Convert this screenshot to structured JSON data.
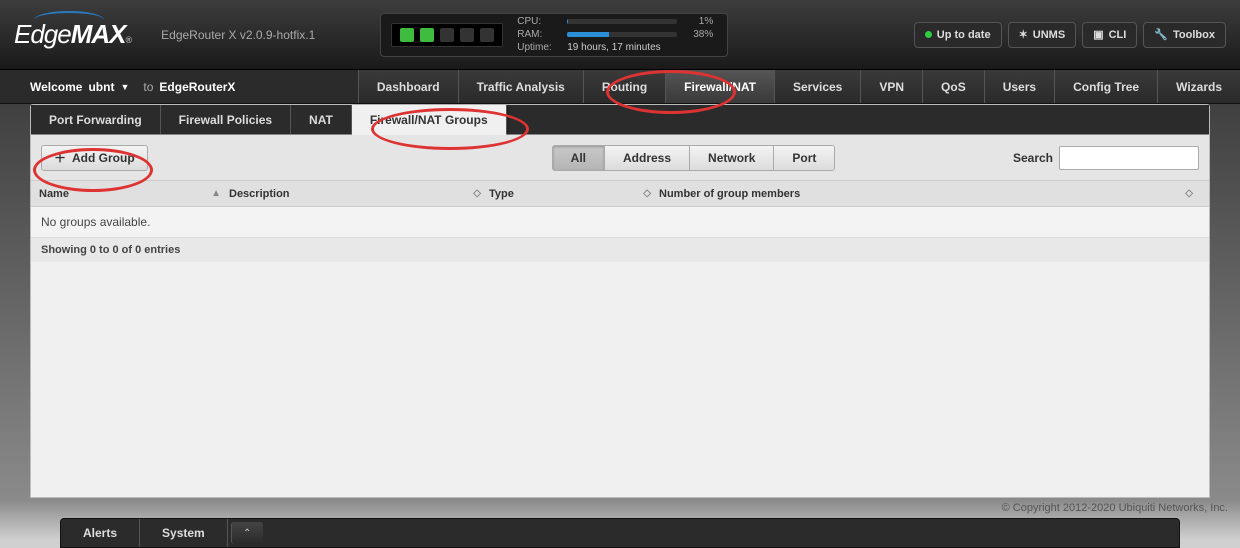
{
  "brand": {
    "part1": "Edge",
    "part2": "MAX",
    "reg": "®"
  },
  "model": "EdgeRouter X v2.0.9-hotfix.1",
  "stats": {
    "cpu_label": "CPU:",
    "cpu_pct": 1,
    "cpu_text": "1%",
    "ram_label": "RAM:",
    "ram_pct": 38,
    "ram_text": "38%",
    "uptime_label": "Uptime:",
    "uptime_text": "19 hours, 17 minutes"
  },
  "header_buttons": {
    "uptodate": "Up to date",
    "unms": "UNMS",
    "cli": "CLI",
    "toolbox": "Toolbox"
  },
  "welcome": {
    "prefix": "Welcome ",
    "user": "ubnt",
    "to": "to ",
    "device": "EdgeRouterX"
  },
  "nav": [
    "Dashboard",
    "Traffic Analysis",
    "Routing",
    "Firewall/NAT",
    "Services",
    "VPN",
    "QoS",
    "Users",
    "Config Tree",
    "Wizards"
  ],
  "nav_active": "Firewall/NAT",
  "subtabs": [
    "Port Forwarding",
    "Firewall Policies",
    "NAT",
    "Firewall/NAT Groups"
  ],
  "subtab_active": "Firewall/NAT Groups",
  "toolbar": {
    "add_label": "Add Group",
    "filters": [
      "All",
      "Address",
      "Network",
      "Port"
    ],
    "filter_active": "All",
    "search_label": "Search"
  },
  "table": {
    "cols": {
      "name": "Name",
      "desc": "Description",
      "type": "Type",
      "members": "Number of group members"
    },
    "empty": "No groups available.",
    "footer": "Showing 0 to 0 of 0 entries"
  },
  "copyright": "© Copyright 2012-2020 Ubiquiti Networks, Inc.",
  "drawer": {
    "alerts": "Alerts",
    "system": "System"
  }
}
